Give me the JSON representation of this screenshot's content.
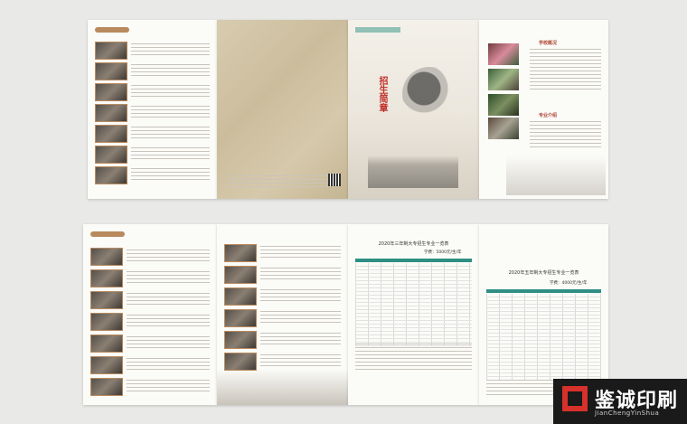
{
  "brochure_top": {
    "cover_title": "招生简章",
    "side_headings": [
      "学校概况",
      "专业介绍"
    ]
  },
  "brochure_bottom": {
    "table1_title": "2020年三年制大专招生专业一览表",
    "table1_fee": "学费：5000元/生/年",
    "table2_title": "2020年五年制大专招生专业一览表",
    "table2_fee": "学费：4000元/生/年"
  },
  "logo": {
    "name": "鉴诚印刷",
    "pinyin": "JianChengYinShua",
    "colors": {
      "mark": "#d6312a",
      "bg": "#1a1a1a"
    }
  }
}
